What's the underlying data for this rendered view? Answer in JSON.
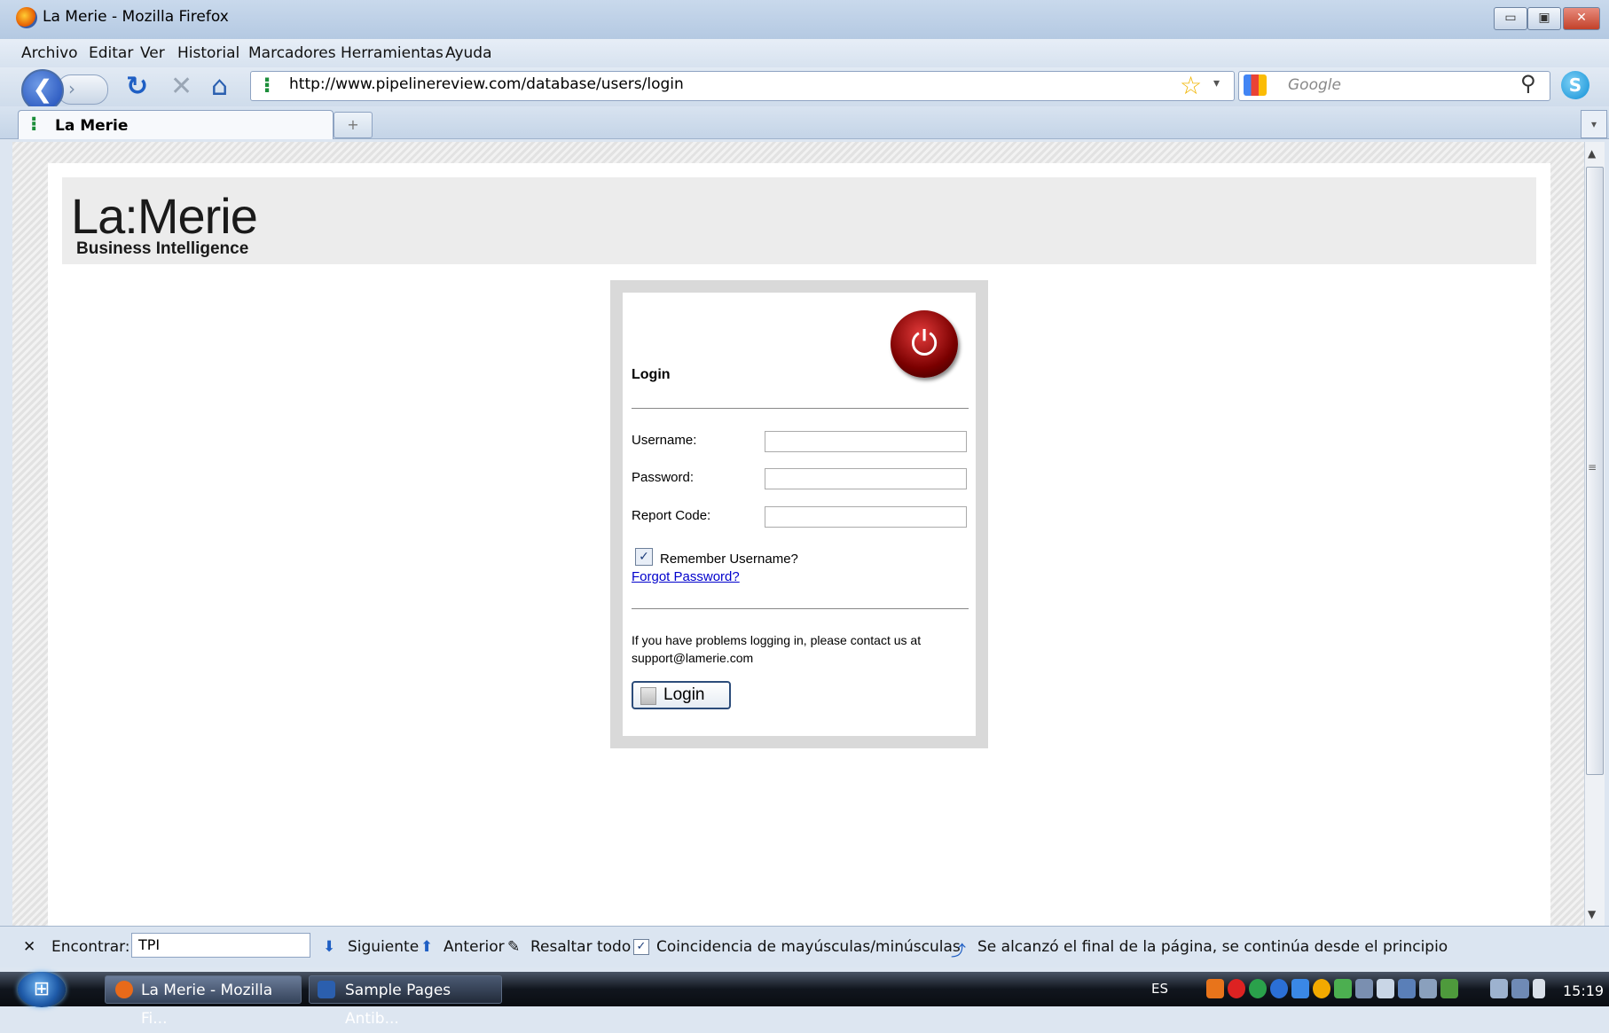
{
  "window": {
    "title": "La Merie - Mozilla Firefox",
    "minimize": "▭",
    "maximize": "▣",
    "close": "✕"
  },
  "menubar": {
    "items": [
      "Archivo",
      "Editar",
      "Ver",
      "Historial",
      "Marcadores",
      "Herramientas",
      "Ayuda"
    ]
  },
  "nav": {
    "url": "http://www.pipelinereview.com/database/users/login",
    "search_placeholder": "Google",
    "icons": {
      "back": "back-arrow-icon",
      "forward": "forward-arrow-icon",
      "reload": "reload-icon",
      "stop": "stop-icon",
      "home": "home-icon",
      "star": "bookmark-star-icon",
      "search": "magnifier-icon"
    },
    "glyphs": {
      "back": "❮",
      "forward": "›",
      "reload": "↻",
      "stop": "✕",
      "home": "⌂",
      "star": "☆",
      "dropdown": "▾",
      "search": "⚲",
      "site": "⁝",
      "skype": "S"
    }
  },
  "tabs": {
    "active_label": "La Merie",
    "new_tab": "+",
    "tab_list": "▾"
  },
  "page": {
    "logo_main": "La:Merie",
    "logo_sub": "Business Intelligence",
    "login": {
      "title": "Login",
      "username_label": "Username:",
      "password_label": "Password:",
      "report_code_label": "Report Code:",
      "username_value": "",
      "password_value": "",
      "report_code_value": "",
      "remember_label": "Remember Username?",
      "remember_checked": true,
      "forgot_link": "Forgot Password?",
      "help_text_1": "If you have problems logging in, please contact us at",
      "help_text_2": "support@lamerie.com",
      "button_label": "Login",
      "power_glyph": "⏻",
      "check_glyph": "✓"
    }
  },
  "scrollbar": {
    "up": "▲",
    "down": "▼",
    "grip": "≡"
  },
  "findbar": {
    "close": "✕",
    "label": "Encontrar:",
    "value": "TPI",
    "next": "Siguiente",
    "prev": "Anterior",
    "highlight": "Resaltar todo",
    "match_case": "Coincidencia de mayúsculas/minúsculas",
    "match_case_checked": true,
    "status": "Se alcanzó el final de la página, se continúa desde el principio",
    "glyphs": {
      "next": "⬇",
      "prev": "⬆",
      "highlight": "✎",
      "status": "⤴"
    }
  },
  "taskbar": {
    "start_glyph": "⊞",
    "items": [
      "La Merie - Mozilla Fi...",
      "Sample Pages Antib..."
    ],
    "language": "ES",
    "time": "15:19",
    "colors": {
      "firefox": "#e86a1a",
      "word": "#2b5fae"
    }
  }
}
